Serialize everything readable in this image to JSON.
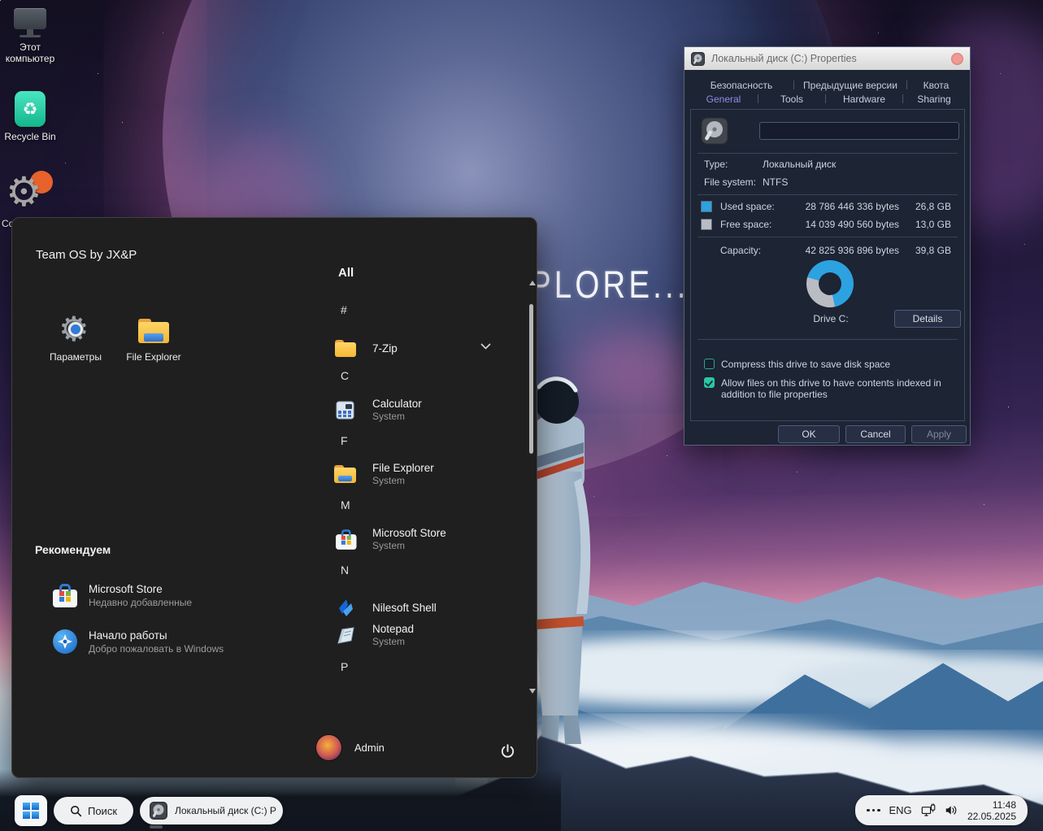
{
  "wallpaper": {
    "headline": "PLORE..."
  },
  "desktop": {
    "icons": [
      {
        "label": "Этот компьютер"
      },
      {
        "label": "Recycle Bin"
      },
      {
        "label": "Co"
      }
    ]
  },
  "start_menu": {
    "brand": "Team OS by JX&P",
    "pinned": [
      {
        "label": "Параметры"
      },
      {
        "label": "File Explorer"
      }
    ],
    "recommended_title": "Рекомендуем",
    "recommended": [
      {
        "title": "Microsoft Store",
        "subtitle": "Недавно добавленные"
      },
      {
        "title": "Начало работы",
        "subtitle": "Добро пожаловать в Windows"
      }
    ],
    "all_label": "All",
    "sections": {
      "s1": "#",
      "s2": "C",
      "s3": "F",
      "s4": "M",
      "s5": "N",
      "s6": "P"
    },
    "apps": [
      {
        "title": "7-Zip",
        "subtitle": ""
      },
      {
        "title": "Calculator",
        "subtitle": "System"
      },
      {
        "title": "File Explorer",
        "subtitle": "System"
      },
      {
        "title": "Microsoft Store",
        "subtitle": "System"
      },
      {
        "title": "Nilesoft Shell",
        "subtitle": ""
      },
      {
        "title": "Notepad",
        "subtitle": "System"
      }
    ],
    "user_name": "Admin"
  },
  "dialog": {
    "title": "Локальный диск (C:) Properties",
    "tabs_row1": [
      {
        "label": "Безопасность"
      },
      {
        "label": "Предыдущие версии"
      },
      {
        "label": "Квота"
      }
    ],
    "tabs_row2": [
      {
        "label": "General"
      },
      {
        "label": "Tools"
      },
      {
        "label": "Hardware"
      },
      {
        "label": "Sharing"
      }
    ],
    "active_tab": "General",
    "volume_label_value": "",
    "fields": {
      "type_label": "Type:",
      "type_value": "Локальный диск",
      "fs_label": "File system:",
      "fs_value": "NTFS",
      "used_label": "Used space:",
      "used_bytes": "28 786 446 336 bytes",
      "used_size": "26,8 GB",
      "free_label": "Free space:",
      "free_bytes": "14 039 490 560 bytes",
      "free_size": "13,0 GB",
      "capacity_label": "Capacity:",
      "capacity_bytes": "42 825 936 896 bytes",
      "capacity_size": "39,8 GB"
    },
    "drive_caption": "Drive C:",
    "details_label": "Details",
    "compress_label": "Compress this drive to save disk space",
    "index_label": "Allow files on this drive to have contents indexed in addition to file properties",
    "ok_label": "OK",
    "cancel_label": "Cancel",
    "apply_label": "Apply"
  },
  "taskbar": {
    "search_label": "Поиск",
    "running_app_label": "Локальный диск (C:) P",
    "language": "ENG",
    "time": "11:48",
    "date": "22.05.2025"
  },
  "chart_data": {
    "type": "pie",
    "title": "Drive C:",
    "labels": [
      "Used space",
      "Free space"
    ],
    "values_gb": [
      26.8,
      13.0
    ],
    "values_bytes": [
      "28 786 446 336",
      "14 039 490 560"
    ],
    "capacity_gb": 39.8,
    "colors": [
      "#2da2e0",
      "#b9bcc2"
    ],
    "legend_position": "above"
  },
  "colors": {
    "accent_blue": "#2da2e0",
    "check_teal": "#2bc7a6",
    "tab_active": "#8a8fe8",
    "close_button": "#f19a93"
  }
}
